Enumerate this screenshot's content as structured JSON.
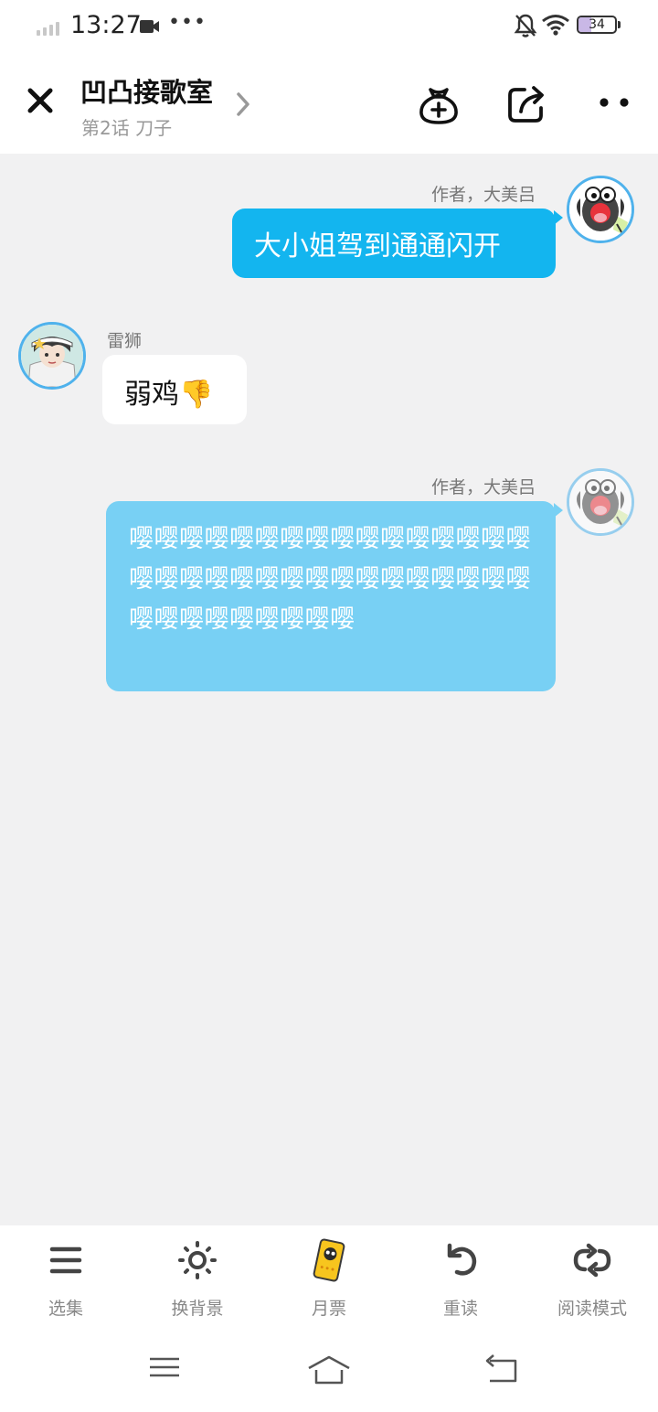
{
  "status_bar": {
    "time": "13:27",
    "battery_percent": "34",
    "battery_level": 0.34
  },
  "header": {
    "title": "凹凸接歌室",
    "subtitle": "第2话 刀子",
    "icons": [
      "close-icon",
      "chevron-right-icon",
      "gift-bag-icon",
      "share-icon",
      "more-icon"
    ]
  },
  "messages": [
    {
      "side": "right",
      "name": "作者，大美吕",
      "text": "大小姐驾到通通闪开",
      "bubble_color": "#13b5ef"
    },
    {
      "side": "left",
      "name": "雷狮",
      "text": "弱鸡👎",
      "bubble_color": "#ffffff"
    },
    {
      "side": "right",
      "name": "作者，大美吕",
      "text": "嘤嘤嘤嘤嘤嘤嘤嘤嘤嘤嘤嘤嘤嘤嘤嘤嘤嘤嘤嘤嘤嘤嘤嘤嘤嘤嘤嘤嘤嘤嘤嘤嘤嘤嘤嘤嘤嘤嘤嘤嘤",
      "bubble_color": "#78d0f4"
    }
  ],
  "toolbar": {
    "items": [
      {
        "label": "选集",
        "icon": "menu-icon"
      },
      {
        "label": "换背景",
        "icon": "sun-icon"
      },
      {
        "label": "月票",
        "icon": "monthly-ticket-icon"
      },
      {
        "label": "重读",
        "icon": "reread-icon"
      },
      {
        "label": "阅读模式",
        "icon": "reading-mode-icon"
      }
    ]
  },
  "nav_bar": {
    "icons": [
      "nav-menu-icon",
      "nav-home-icon",
      "nav-back-icon"
    ]
  },
  "colors": {
    "accent": "#13b5ef",
    "background": "#f1f1f2",
    "avatar_border": "#4fb2ec"
  }
}
